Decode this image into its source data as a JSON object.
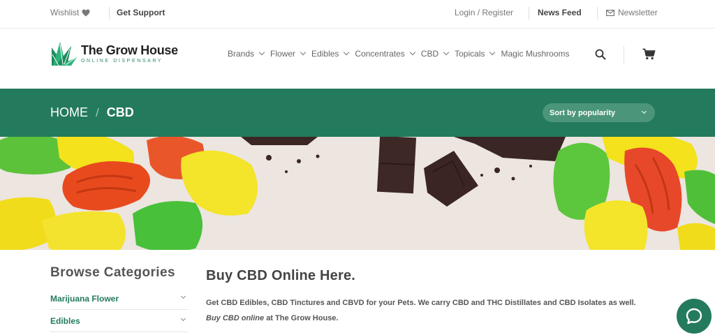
{
  "topbar": {
    "wishlist": "Wishlist",
    "support": "Get Support",
    "login": "Login / Register",
    "news_feed": "News Feed",
    "newsletter": "Newsletter"
  },
  "logo": {
    "title": "The Grow House",
    "subtitle": "ONLINE DISPENSARY"
  },
  "nav": {
    "items": [
      {
        "label": "Brands",
        "icon": "chevron-down-icon"
      },
      {
        "label": "Flower",
        "icon": "chevron-down-icon"
      },
      {
        "label": "Edibles",
        "icon": "chevron-down-icon"
      },
      {
        "label": "Concentrates",
        "icon": "chevron-down-icon"
      },
      {
        "label": "CBD",
        "icon": "chevron-down-icon"
      },
      {
        "label": "Topicals",
        "icon": "chevron-down-icon"
      },
      {
        "label": "Magic Mushrooms"
      }
    ]
  },
  "breadcrumb": {
    "home": "HOME",
    "separator": "/",
    "current": "CBD"
  },
  "sort": {
    "selected": "Sort by popularity"
  },
  "sidebar": {
    "title": "Browse Categories",
    "categories": [
      {
        "label": "Marijuana Flower"
      },
      {
        "label": "Edibles"
      }
    ]
  },
  "main": {
    "heading": "Buy CBD Online Here.",
    "intro": "Get CBD Edibles, CBD Tinctures and CBVD for your Pets. We carry CBD and THC Distillates and CBD Isolates as well.",
    "intro_em": "Buy CBD online",
    "intro_tail": "at The Grow House."
  },
  "colors": {
    "brand_green": "#247a5d",
    "band_button": "#4b957a",
    "banner_bg": "#ece5e0"
  },
  "icons": {
    "wishlist": "heart-icon",
    "newsletter": "envelope-icon",
    "search": "search-icon",
    "cart": "cart-icon",
    "chat": "chat-icon"
  }
}
